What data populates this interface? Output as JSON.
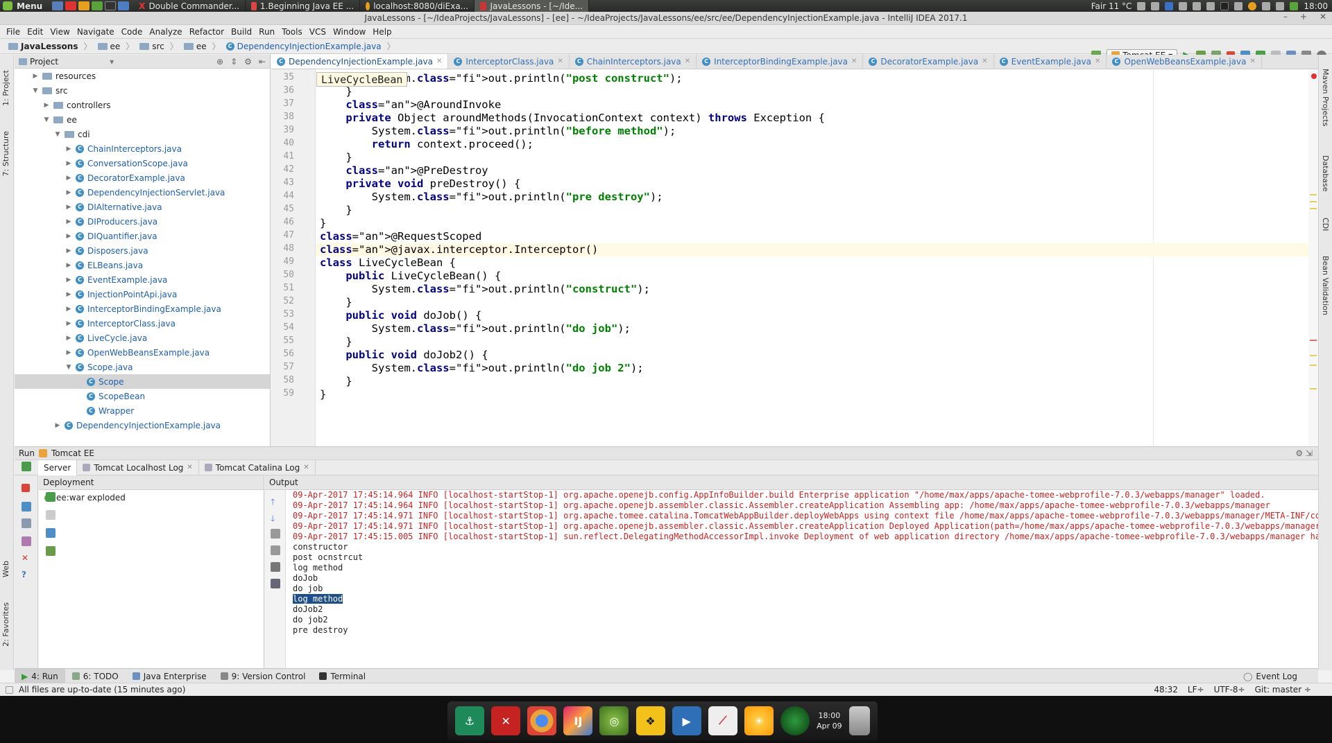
{
  "panel": {
    "menu": "Menu",
    "tasks": [
      "Double Commander...",
      "1.Beginning Java EE ...",
      "localhost:8080/diExa...",
      "JavaLessons - [~/Ide..."
    ],
    "weather": "Fair 11 °C",
    "time": "18:00"
  },
  "window": {
    "title": "JavaLessons - [~/IdeaProjects/JavaLessons] - [ee] - ~/IdeaProjects/JavaLessons/ee/src/ee/DependencyInjectionExample.java - IntelliJ IDEA 2017.1"
  },
  "menubar": [
    "File",
    "Edit",
    "View",
    "Navigate",
    "Code",
    "Analyze",
    "Refactor",
    "Build",
    "Run",
    "Tools",
    "VCS",
    "Window",
    "Help"
  ],
  "breadcrumbs": [
    "JavaLessons",
    "ee",
    "src",
    "ee",
    "DependencyInjectionExample.java"
  ],
  "run_config": "Tomcat EE",
  "project": {
    "header": "Project",
    "nodes": [
      {
        "label": "resources",
        "indent": 1,
        "arrow": "▶",
        "kind": "folder"
      },
      {
        "label": "src",
        "indent": 1,
        "arrow": "▼",
        "kind": "folder"
      },
      {
        "label": "controllers",
        "indent": 2,
        "arrow": "▶",
        "kind": "folder"
      },
      {
        "label": "ee",
        "indent": 2,
        "arrow": "▼",
        "kind": "folder"
      },
      {
        "label": "cdi",
        "indent": 3,
        "arrow": "▼",
        "kind": "folder"
      },
      {
        "label": "ChainInterceptors.java",
        "indent": 4,
        "arrow": "▶",
        "kind": "java"
      },
      {
        "label": "ConversationScope.java",
        "indent": 4,
        "arrow": "▶",
        "kind": "java"
      },
      {
        "label": "DecoratorExample.java",
        "indent": 4,
        "arrow": "▶",
        "kind": "java"
      },
      {
        "label": "DependencyInjectionServlet.java",
        "indent": 4,
        "arrow": "▶",
        "kind": "java"
      },
      {
        "label": "DIAlternative.java",
        "indent": 4,
        "arrow": "▶",
        "kind": "java"
      },
      {
        "label": "DIProducers.java",
        "indent": 4,
        "arrow": "▶",
        "kind": "java"
      },
      {
        "label": "DIQuantifier.java",
        "indent": 4,
        "arrow": "▶",
        "kind": "java"
      },
      {
        "label": "Disposers.java",
        "indent": 4,
        "arrow": "▶",
        "kind": "java"
      },
      {
        "label": "ELBeans.java",
        "indent": 4,
        "arrow": "▶",
        "kind": "java"
      },
      {
        "label": "EventExample.java",
        "indent": 4,
        "arrow": "▶",
        "kind": "java"
      },
      {
        "label": "InjectionPointApi.java",
        "indent": 4,
        "arrow": "▶",
        "kind": "java"
      },
      {
        "label": "InterceptorBindingExample.java",
        "indent": 4,
        "arrow": "▶",
        "kind": "java"
      },
      {
        "label": "InterceptorClass.java",
        "indent": 4,
        "arrow": "▶",
        "kind": "java"
      },
      {
        "label": "LiveCycle.java",
        "indent": 4,
        "arrow": "▶",
        "kind": "java"
      },
      {
        "label": "OpenWebBeansExample.java",
        "indent": 4,
        "arrow": "▶",
        "kind": "java"
      },
      {
        "label": "Scope.java",
        "indent": 4,
        "arrow": "▼",
        "kind": "java"
      },
      {
        "label": "Scope",
        "indent": 5,
        "arrow": "",
        "kind": "java",
        "selected": true
      },
      {
        "label": "ScopeBean",
        "indent": 5,
        "arrow": "",
        "kind": "java"
      },
      {
        "label": "Wrapper",
        "indent": 5,
        "arrow": "",
        "kind": "java"
      },
      {
        "label": "DependencyInjectionExample.java",
        "indent": 3,
        "arrow": "▶",
        "kind": "java"
      }
    ]
  },
  "editor": {
    "tabs": [
      "DependencyInjectionExample.java",
      "InterceptorClass.java",
      "ChainInterceptors.java",
      "InterceptorBindingExample.java",
      "DecoratorExample.java",
      "EventExample.java",
      "OpenWebBeansExample.java"
    ],
    "active_tab": 0,
    "hint": "LiveCycleBean",
    "first_line": 35,
    "current_line": 48,
    "lines": [
      "        System.out.println(\"post construct\");",
      "    }",
      "    @AroundInvoke",
      "    private Object aroundMethods(InvocationContext context) throws Exception {",
      "        System.out.println(\"before method\");",
      "        return context.proceed();",
      "    }",
      "    @PreDestroy",
      "    private void preDestroy() {",
      "        System.out.println(\"pre destroy\");",
      "    }",
      "}",
      "@RequestScoped",
      "@javax.interceptor.Interceptor()",
      "class LiveCycleBean {",
      "    public LiveCycleBean() {",
      "        System.out.println(\"construct\");",
      "    }",
      "    public void doJob() {",
      "        System.out.println(\"do job\");",
      "    }",
      "    public void doJob2() {",
      "        System.out.println(\"do job 2\");",
      "    }",
      "}"
    ]
  },
  "run": {
    "title": "Run",
    "config": "Tomcat EE",
    "tabs": [
      "Server",
      "Tomcat Localhost Log",
      "Tomcat Catalina Log"
    ],
    "deployment_header": "Deployment",
    "deployment_item": "ee:war exploded",
    "output_header": "Output",
    "output_lines": [
      {
        "t": "09-Apr-2017 17:45:14.964 INFO [localhost-startStop-1] org.apache.openejb.config.AppInfoBuilder.build Enterprise application \"/home/max/apps/apache-tomee-webprofile-7.0.3/webapps/manager\" loaded.",
        "err": true
      },
      {
        "t": "09-Apr-2017 17:45:14.964 INFO [localhost-startStop-1] org.apache.openejb.assembler.classic.Assembler.createApplication Assembling app: /home/max/apps/apache-tomee-webprofile-7.0.3/webapps/manager",
        "err": true
      },
      {
        "t": "09-Apr-2017 17:45:14.971 INFO [localhost-startStop-1] org.apache.tomee.catalina.TomcatWebAppBuilder.deployWebApps using context file /home/max/apps/apache-tomee-webprofile-7.0.3/webapps/manager/META-INF/context.",
        "err": true
      },
      {
        "t": "09-Apr-2017 17:45:14.971 INFO [localhost-startStop-1] org.apache.openejb.assembler.classic.Assembler.createApplication Deployed Application(path=/home/max/apps/apache-tomee-webprofile-7.0.3/webapps/manager)",
        "err": true
      },
      {
        "t": "09-Apr-2017 17:45:15.005 INFO [localhost-startStop-1] sun.reflect.DelegatingMethodAccessorImpl.invoke Deployment of web application directory /home/max/apps/apache-tomee-webprofile-7.0.3/webapps/manager has fini",
        "err": true
      },
      {
        "t": "constructor",
        "err": false
      },
      {
        "t": "post ocnstrcut",
        "err": false
      },
      {
        "t": "log method",
        "err": false
      },
      {
        "t": "doJob",
        "err": false
      },
      {
        "t": "do job",
        "err": false
      },
      {
        "t": "log method",
        "err": false,
        "highlight": true
      },
      {
        "t": "doJob2",
        "err": false
      },
      {
        "t": "do job2",
        "err": false
      },
      {
        "t": "pre destroy",
        "err": false
      }
    ]
  },
  "bottom_tabs": [
    "4: Run",
    "6: TODO",
    "Java Enterprise",
    "9: Version Control",
    "Terminal"
  ],
  "event_log": "Event Log",
  "left_tool_windows": [
    "1: Project",
    "7: Structure",
    "Web",
    "2: Favorites"
  ],
  "right_tool_windows": [
    "Maven Projects",
    "Database",
    "CDI",
    "Bean Validation"
  ],
  "status": {
    "message": "All files are up-to-date (15 minutes ago)",
    "position": "48:32",
    "line_sep": "LF÷",
    "encoding": "UTF-8÷",
    "git": "Git: master ÷"
  },
  "dock": {
    "time": "18:00",
    "date": "Apr 09"
  }
}
